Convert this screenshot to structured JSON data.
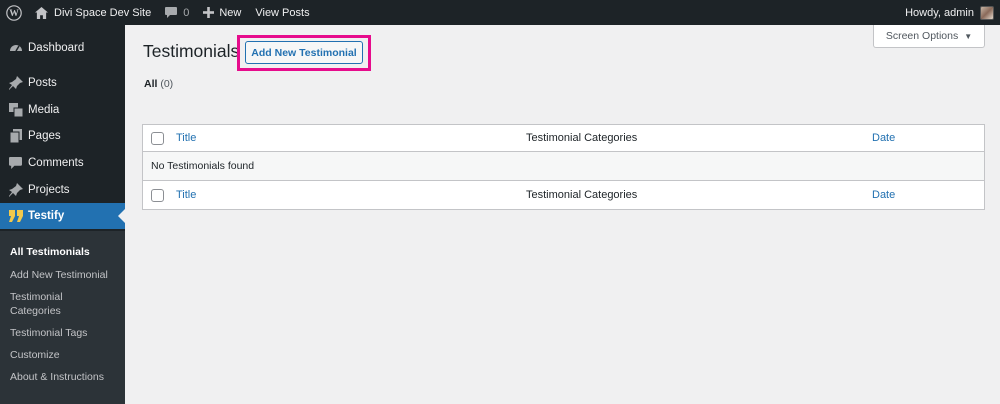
{
  "adminbar": {
    "site_name": "Divi Space Dev Site",
    "comments_count": "0",
    "new_label": "New",
    "view_posts_label": "View Posts",
    "howdy": "Howdy, admin"
  },
  "sidebar": {
    "items": [
      {
        "label": "Dashboard",
        "icon": "dashboard-icon"
      },
      {
        "label": "Posts",
        "icon": "pin-icon"
      },
      {
        "label": "Media",
        "icon": "media-icon"
      },
      {
        "label": "Pages",
        "icon": "pages-icon"
      },
      {
        "label": "Comments",
        "icon": "comment-icon"
      },
      {
        "label": "Projects",
        "icon": "pin-icon"
      },
      {
        "label": "Testify",
        "icon": "quote-icon"
      }
    ],
    "submenu": [
      {
        "label": "All Testimonials"
      },
      {
        "label": "Add New Testimonial"
      },
      {
        "label": "Testimonial Categories"
      },
      {
        "label": "Testimonial Tags"
      },
      {
        "label": "Customize"
      },
      {
        "label": "About & Instructions"
      }
    ]
  },
  "main": {
    "screen_options": "Screen Options",
    "title": "Testimonials",
    "add_new": "Add New Testimonial",
    "filter_all": "All",
    "filter_count": "(0)",
    "table": {
      "columns": [
        "Title",
        "Testimonial Categories",
        "Date"
      ],
      "empty_message": "No Testimonials found"
    }
  },
  "colors": {
    "admin_dark": "#1d2327",
    "accent": "#2271b1",
    "highlight": "#e60c8c",
    "background": "#f0f0f1"
  }
}
